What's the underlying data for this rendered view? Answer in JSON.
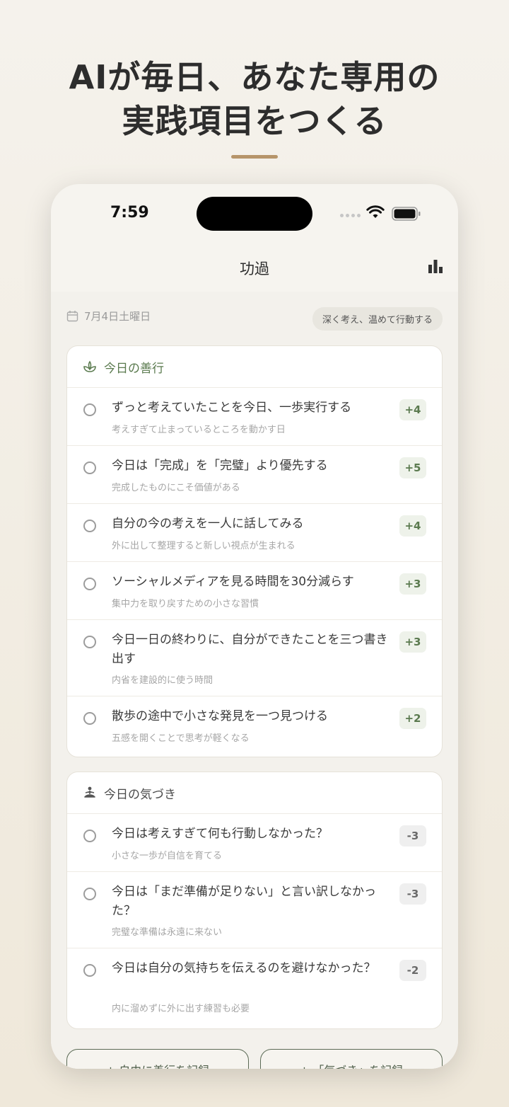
{
  "headline": {
    "line1": "AIが毎日、あなた専用の",
    "line2": "実践項目をつくる"
  },
  "status_bar": {
    "time": "7:59"
  },
  "app": {
    "title": "功過",
    "stats_icon": "bar-chart-icon"
  },
  "date_row": {
    "icon": "calendar-icon",
    "date": "7月4日土曜日"
  },
  "theme": "深く考え、温めて行動する",
  "good_section": {
    "icon": "sprout-icon",
    "title": "今日の善行",
    "items": [
      {
        "title": "ずっと考えていたことを今日、一歩実行する",
        "subtitle": "考えすぎて止まっているところを動かす日",
        "points": "+4"
      },
      {
        "title": "今日は「完成」を「完璧」より優先する",
        "subtitle": "完成したものにこそ価値がある",
        "points": "+5"
      },
      {
        "title": "自分の今の考えを一人に話してみる",
        "subtitle": "外に出して整理すると新しい視点が生まれる",
        "points": "+4"
      },
      {
        "title": "ソーシャルメディアを見る時間を30分減らす",
        "subtitle": "集中力を取り戻すための小さな習慣",
        "points": "+3"
      },
      {
        "title": "今日一日の終わりに、自分ができたことを三つ書き出す",
        "subtitle": "内省を建設的に使う時間",
        "points": "+3"
      },
      {
        "title": "散歩の途中で小さな発見を一つ見つける",
        "subtitle": "五感を開くことで思考が軽くなる",
        "points": "+2"
      }
    ]
  },
  "notice_section": {
    "icon": "meditation-icon",
    "title": "今日の気づき",
    "items": [
      {
        "title": "今日は考えすぎて何も行動しなかった？",
        "subtitle": "小さな一歩が自信を育てる",
        "points": "-3"
      },
      {
        "title": "今日は「まだ準備が足りない」と言い訳しなかった？",
        "subtitle": "完璧な準備は永遠に来ない",
        "points": "-3"
      },
      {
        "title": "今日は自分の気持ちを伝えるのを避けなかった？",
        "subtitle": "内に溜めずに外に出す練習も必要",
        "points": "-2"
      }
    ]
  },
  "buttons": {
    "record_good": "+ 自由に善行を記録",
    "record_notice": "+ 「気づき」を記録"
  }
}
